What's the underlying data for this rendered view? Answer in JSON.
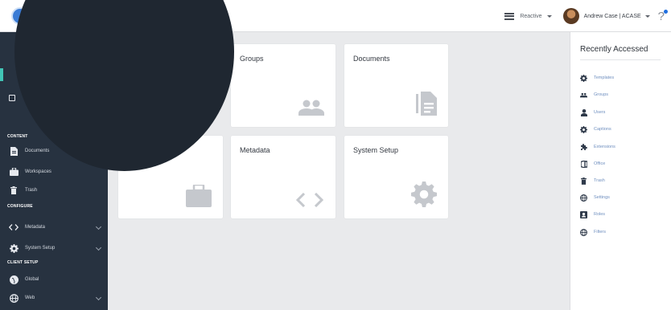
{
  "header": {
    "view_label": "Reactive",
    "user_name": "Andrew Case | ACASE",
    "help_label": "?"
  },
  "sidebar": {
    "sections": [
      {
        "heading": "CONTENT"
      },
      {
        "heading": "CONFIGURE"
      },
      {
        "heading": "CLIENT SETUP"
      }
    ],
    "items": [
      {
        "label": "Documents",
        "icon": "document-icon"
      },
      {
        "label": "Workspaces",
        "icon": "briefcase-icon"
      },
      {
        "label": "Trash",
        "icon": "trash-icon"
      },
      {
        "label": "Metadata",
        "icon": "code-icon",
        "expandable": true
      },
      {
        "label": "System Setup",
        "icon": "gear-icon",
        "expandable": true
      },
      {
        "label": "Global",
        "icon": "globe-icon"
      },
      {
        "label": "Web",
        "icon": "web-icon",
        "expandable": true
      }
    ]
  },
  "cards": [
    {
      "title": "Groups",
      "icon": "groups-icon"
    },
    {
      "title": "Documents",
      "icon": "document-icon"
    },
    {
      "title": "",
      "icon": "briefcase-icon"
    },
    {
      "title": "Metadata",
      "icon": "code-icon"
    },
    {
      "title": "System Setup",
      "icon": "gear-icon"
    }
  ],
  "recent": {
    "title": "Recently Accessed",
    "items": [
      {
        "label": "Templates",
        "icon": "gear-icon"
      },
      {
        "label": "Groups",
        "icon": "groups-icon"
      },
      {
        "label": "Users",
        "icon": "user-icon"
      },
      {
        "label": "Captions",
        "icon": "gear-icon"
      },
      {
        "label": "Extensions",
        "icon": "puzzle-icon"
      },
      {
        "label": "Office",
        "icon": "office-icon"
      },
      {
        "label": "Trash",
        "icon": "trash-icon"
      },
      {
        "label": "Settings",
        "icon": "settings-icon"
      },
      {
        "label": "Roles",
        "icon": "roles-icon"
      },
      {
        "label": "Filters",
        "icon": "filter-icon"
      }
    ]
  },
  "colors": {
    "sidebar_bg": "#273240",
    "accent_teal": "#41c5b6",
    "link_blue": "#6f8fbf",
    "page_bg": "#e9eaec",
    "overlay": "#1f2731"
  }
}
